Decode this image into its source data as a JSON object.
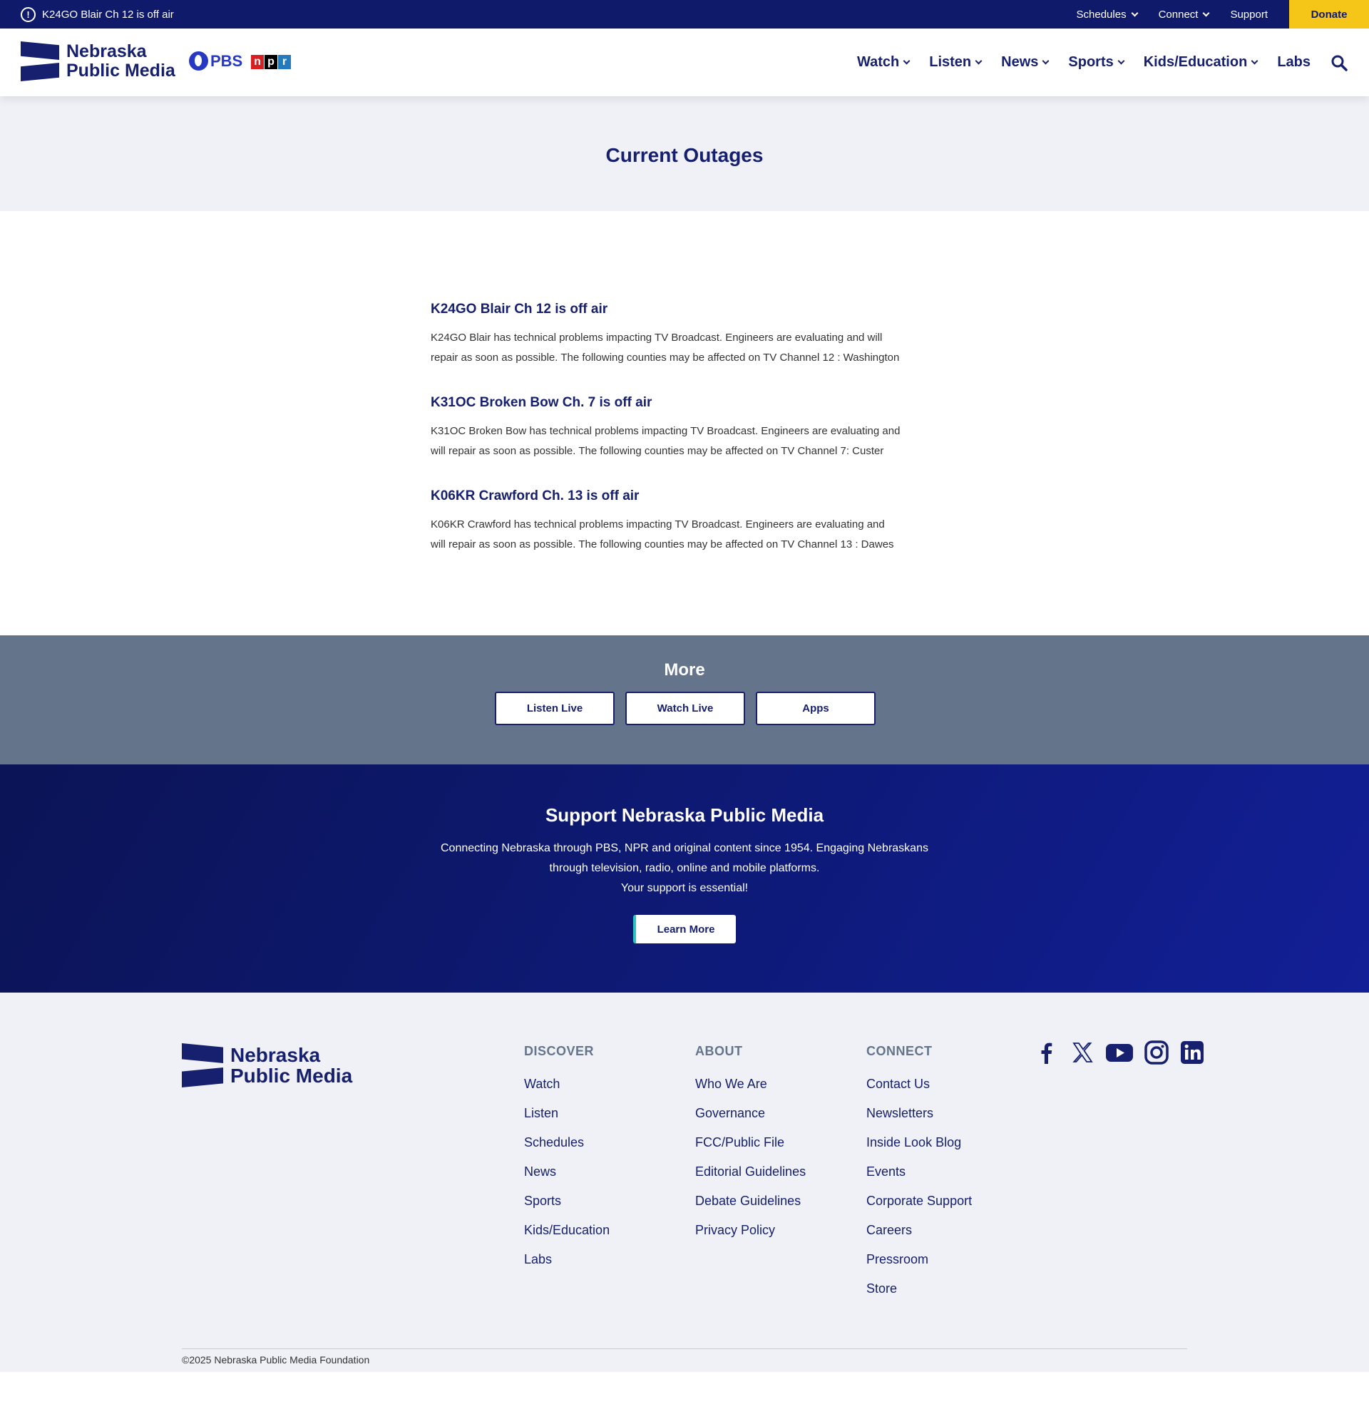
{
  "topbar": {
    "alert_text": "K24GO Blair Ch 12 is off air",
    "alert_icon": "exclamation-circle-icon",
    "utility": [
      {
        "label": "Schedules",
        "dropdown": true
      },
      {
        "label": "Connect",
        "dropdown": true
      },
      {
        "label": "Support",
        "dropdown": false
      }
    ],
    "donate_label": "Donate",
    "donate_color": "#f5c518",
    "bar_color": "#0f1a6b"
  },
  "header": {
    "logo_line1": "Nebraska",
    "logo_line2": "Public Media",
    "pbs_label": "PBS",
    "npr_letters": [
      "n",
      "p",
      "r"
    ],
    "npr_colors": [
      "#d62021",
      "#000000",
      "#237bbd"
    ],
    "nav": [
      {
        "label": "Watch",
        "dropdown": true
      },
      {
        "label": "Listen",
        "dropdown": true
      },
      {
        "label": "News",
        "dropdown": true
      },
      {
        "label": "Sports",
        "dropdown": true
      },
      {
        "label": "Kids/Education",
        "dropdown": true
      },
      {
        "label": "Labs",
        "dropdown": false
      }
    ],
    "search_icon": "search-icon"
  },
  "hero": {
    "title": "Current Outages"
  },
  "outages": [
    {
      "title": "K24GO Blair Ch 12 is off air",
      "body_line1": "K24GO Blair has technical problems impacting TV Broadcast. Engineers are evaluating and will",
      "body_line2": "repair as soon as possible. The following counties may be affected on TV Channel 12 : Washington"
    },
    {
      "title": "K31OC Broken Bow Ch. 7 is off air",
      "body_line1": "K31OC Broken Bow has technical problems impacting TV Broadcast. Engineers are evaluating and",
      "body_line2": "will repair as soon as possible. The following counties may be affected on TV Channel 7: Custer"
    },
    {
      "title": "K06KR Crawford Ch. 13 is off air",
      "body_line1": "K06KR Crawford has technical problems impacting TV Broadcast.  Engineers are evaluating and",
      "body_line2": "will repair as soon as possible.  The following counties may be affected on TV Channel 13 : Dawes"
    }
  ],
  "more": {
    "title": "More",
    "buttons": [
      "Listen Live",
      "Watch Live",
      "Apps"
    ]
  },
  "support": {
    "title": "Support Nebraska Public Media",
    "line1": "Connecting Nebraska through PBS, NPR and original content since 1954. Engaging Nebraskans",
    "line2": "through television, radio, online and mobile platforms.",
    "line3": "Your support is essential!",
    "button": "Learn More"
  },
  "footer": {
    "logo_line1": "Nebraska",
    "logo_line2": "Public Media",
    "columns": [
      {
        "heading": "DISCOVER",
        "links": [
          "Watch",
          "Listen",
          "Schedules",
          "News",
          "Sports",
          "Kids/Education",
          "Labs"
        ]
      },
      {
        "heading": "ABOUT",
        "links": [
          "Who We Are",
          "Governance",
          "FCC/Public File",
          "Editorial Guidelines",
          "Debate Guidelines",
          "Privacy Policy"
        ]
      },
      {
        "heading": "CONNECT",
        "links": [
          "Contact Us",
          "Newsletters",
          "Inside Look Blog",
          "Events",
          "Corporate Support",
          "Careers",
          "Pressroom",
          "Store"
        ]
      }
    ],
    "social": [
      "facebook-icon",
      "x-twitter-icon",
      "youtube-icon",
      "instagram-icon",
      "linkedin-icon"
    ],
    "copyright": "©2025 Nebraska Public Media Foundation"
  }
}
